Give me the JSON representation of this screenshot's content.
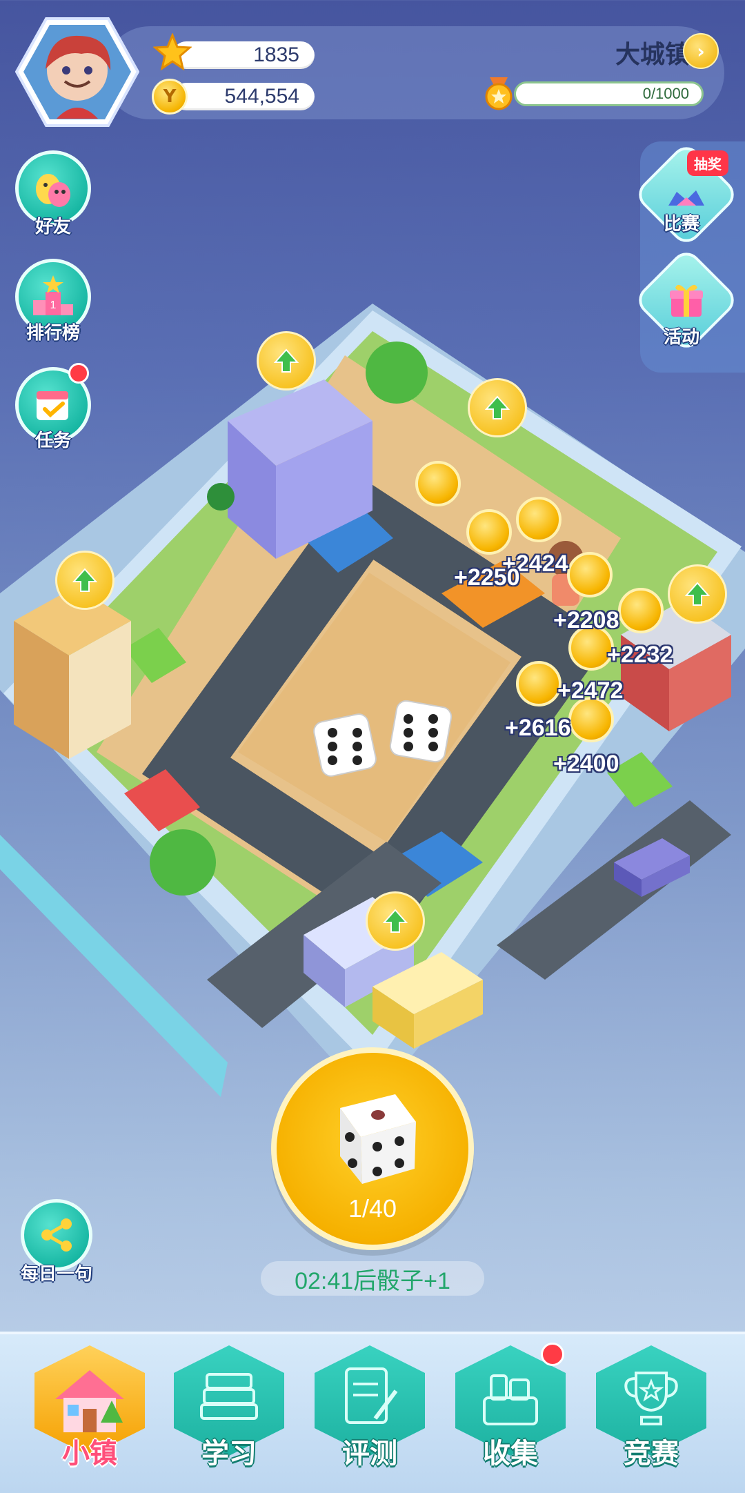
{
  "hud": {
    "stars": "1835",
    "coins": "544,554",
    "town_name": "大城镇",
    "xp_text": "0/1000",
    "xp_progress": 0
  },
  "left_buttons": [
    {
      "label": "好友"
    },
    {
      "label": "排行榜",
      "rank_number": "1"
    },
    {
      "label": "任务"
    }
  ],
  "right_buttons": {
    "contest": {
      "label": "比赛",
      "badge": "抽奖"
    },
    "event": {
      "label": "活动"
    }
  },
  "rewards": [
    "+2424",
    "+2250",
    "+2208",
    "+2232",
    "+2472",
    "+2616",
    "+2400"
  ],
  "share_button": {
    "label": "每日一句"
  },
  "dice": {
    "count": "1/40"
  },
  "timer": "02:41后骰子+1",
  "bottom_nav": [
    {
      "label": "小镇",
      "active": true
    },
    {
      "label": "学习"
    },
    {
      "label": "评测"
    },
    {
      "label": "收集",
      "notify": true
    },
    {
      "label": "竞赛"
    }
  ],
  "colors": {
    "accent_teal": "#1db2a1",
    "gold": "#f6b100",
    "timer_green": "#22a66b"
  }
}
